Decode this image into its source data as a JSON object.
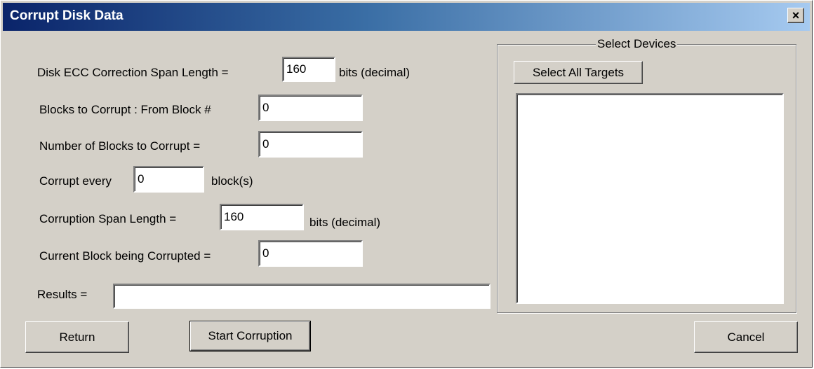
{
  "window": {
    "title": "Corrupt Disk Data",
    "close_symbol": "×"
  },
  "form": {
    "ecc_span": {
      "label": "Disk ECC Correction Span Length =",
      "value": "160",
      "unit": "bits (decimal)"
    },
    "from_block": {
      "label": "Blocks to Corrupt : From Block #",
      "value": "0"
    },
    "num_blocks": {
      "label": "Number of Blocks to Corrupt =",
      "value": "0"
    },
    "corrupt_every": {
      "label": "Corrupt every",
      "value": "0",
      "unit": "block(s)"
    },
    "corruption_span": {
      "label": "Corruption Span Length =",
      "value": "160",
      "unit": "bits (decimal)"
    },
    "current_block": {
      "label": "Current Block being Corrupted =",
      "value": "0"
    },
    "results": {
      "label": "Results =",
      "value": ""
    }
  },
  "devices": {
    "group_title": "Select Devices",
    "select_all_label": "Select All Targets",
    "items": []
  },
  "buttons": {
    "return_label": "Return",
    "start_label": "Start Corruption",
    "cancel_label": "Cancel"
  },
  "colors": {
    "face": "#d4d0c8",
    "title_start": "#0a246a",
    "title_end": "#a6caf0"
  }
}
